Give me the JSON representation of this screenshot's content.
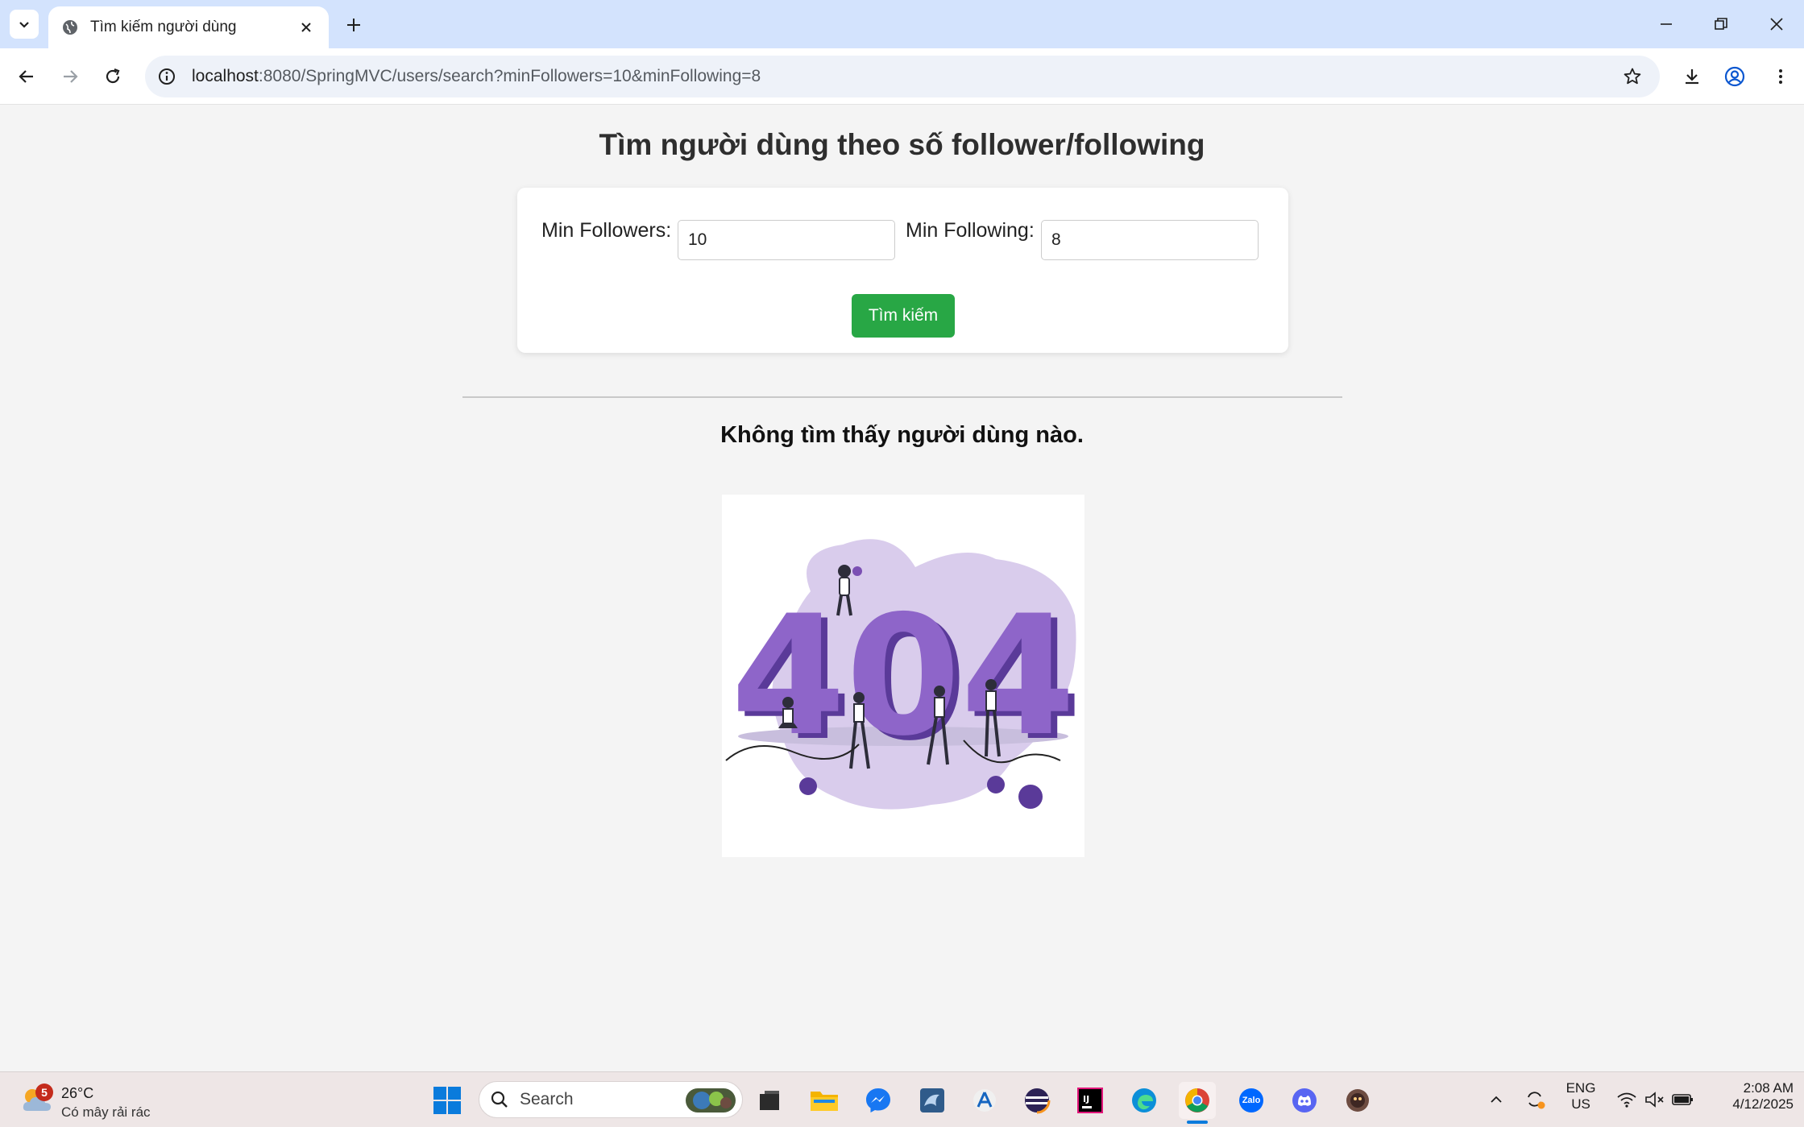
{
  "browser": {
    "tab_title": "Tìm kiếm người dùng",
    "url_host": "localhost",
    "url_rest": ":8080/SpringMVC/users/search?minFollowers=10&minFollowing=8"
  },
  "page": {
    "title": "Tìm người dùng theo số follower/following",
    "form": {
      "min_followers_label": "Min Followers:",
      "min_followers_value": "10",
      "min_following_label": "Min Following:",
      "min_following_value": "8",
      "submit_label": "Tìm kiếm"
    },
    "empty_message": "Không tìm thấy người dùng nào.",
    "illustration_text": "404"
  },
  "taskbar": {
    "weather": {
      "temp": "26°C",
      "desc": "Có mây rải rác",
      "badge": "5"
    },
    "search_label": "Search",
    "language": {
      "line1": "ENG",
      "line2": "US"
    },
    "clock": {
      "time": "2:08 AM",
      "date": "4/12/2025"
    },
    "pinned_apps": [
      "windows-start",
      "search",
      "file-explorer-dark",
      "file-explorer",
      "messenger",
      "mysql-workbench",
      "app-store",
      "eclipse",
      "intellij",
      "edge",
      "chrome",
      "zalo",
      "discord",
      "game-app"
    ],
    "zalo_label": "Zalo"
  },
  "colors": {
    "tabbar": "#d3e3fd",
    "page_bg": "#f4f4f4",
    "button_green": "#28a745",
    "illustration_purple": "#7b4fb3"
  }
}
